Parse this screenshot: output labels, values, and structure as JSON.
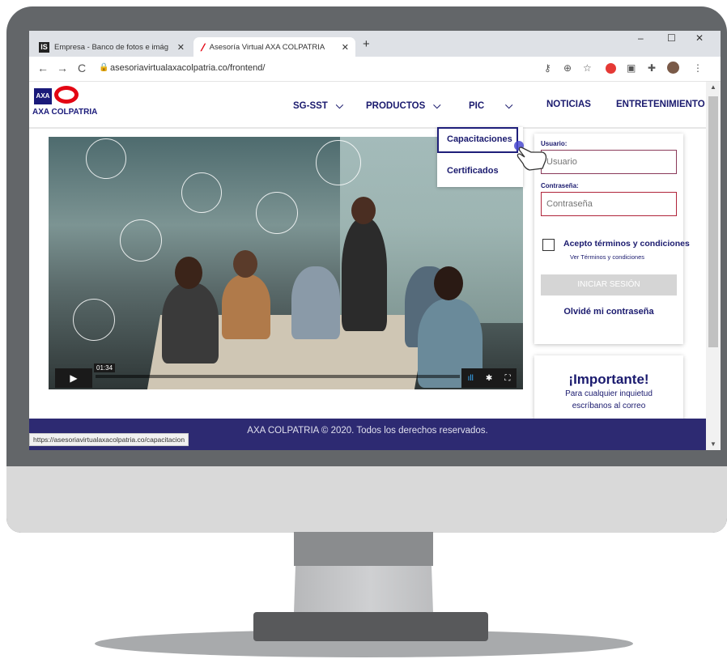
{
  "browser": {
    "tabs": [
      {
        "label": "Empresa - Banco de fotos e imág",
        "favicon": "IS",
        "active": false
      },
      {
        "label": "Asesoría Virtual AXA COLPATRIA",
        "favicon": "axa-slash-icon",
        "active": true
      }
    ],
    "new_tab": "+",
    "window_controls": {
      "minimize": "–",
      "maximize": "☐",
      "close": "✕"
    },
    "url": "asesoriavirtualaxacolpatria.co/frontend/",
    "status_url": "https://asesoriavirtualaxacolpatria.co/capacitacion"
  },
  "site": {
    "logo_text": "AXA COLPATRIA",
    "logo_box": "AXA",
    "nav": [
      {
        "label": "SG-SST",
        "has_dropdown": true
      },
      {
        "label": "PRODUCTOS",
        "has_dropdown": true
      },
      {
        "label": "PIC",
        "has_dropdown": true
      },
      {
        "label": "NOTICIAS",
        "has_dropdown": false
      },
      {
        "label": "ENTRETENIMIENTO",
        "has_dropdown": false
      }
    ],
    "dropdown": [
      "Capacitaciones",
      "Certificados"
    ],
    "video": {
      "time": "01:34"
    },
    "login": {
      "user_label": "Usuario:",
      "user_placeholder": "Usuario",
      "pass_label": "Contraseña:",
      "pass_placeholder": "Contraseña",
      "terms_label": "Acepto términos y condiciones",
      "terms_link": "Ver Términos y condiciones",
      "login_button": "INICIAR SESIÓN",
      "forgot": "Olvidé mi contraseña"
    },
    "important": {
      "title": "¡Importante!",
      "line1": "Para cualquier inquietud",
      "line2": "escríbanos al correo"
    },
    "footer": "AXA COLPATRIA © 2020. Todos los derechos reservados."
  },
  "colors": {
    "brand_navy": "#1a1a6e",
    "brand_red": "#e30613",
    "footer": "#2d2a72"
  }
}
